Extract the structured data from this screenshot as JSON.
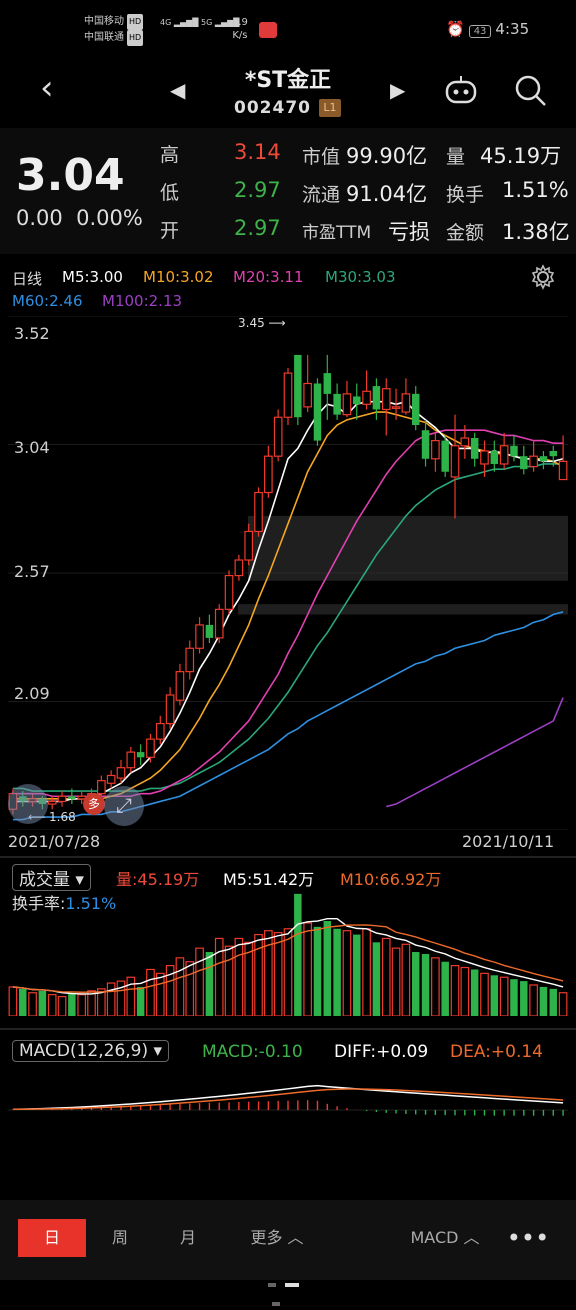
{
  "status_bar": {
    "carrier1": "中国移动",
    "carrier2": "中国联通",
    "hd": "HD",
    "sig": "4G",
    "net_speed": "1.9",
    "net_unit": "K/s",
    "battery": "43",
    "time": "4:35"
  },
  "header": {
    "title": "*ST金正",
    "code": "002470",
    "badge": "L1"
  },
  "quote": {
    "price": "3.04",
    "change": "0.00",
    "change_pct": "0.00%",
    "high_label": "高",
    "high": "3.14",
    "low_label": "低",
    "low": "2.97",
    "open_label": "开",
    "open": "2.97",
    "mktcap_label": "市值",
    "mktcap": "99.90亿",
    "float_label": "流通",
    "float": "91.04亿",
    "pe_label": "市盈TTM",
    "pe": "亏损",
    "vol_label": "量",
    "vol": "45.19万",
    "turn_label": "换手",
    "turn": "1.51%",
    "amt_label": "金额",
    "amt": "1.38亿"
  },
  "indicators": {
    "period": "日线",
    "m5": "M5:3.00",
    "m10": "M10:3.02",
    "m20": "M20:3.11",
    "m30": "M30:3.03",
    "m60": "M60:2.46",
    "m100": "M100:2.13",
    "colors": {
      "m5": "#ffffff",
      "m10": "#f5a623",
      "m20": "#e040b0",
      "m30": "#2aa87a",
      "m60": "#2f8fe0",
      "m100": "#9b3fc4"
    }
  },
  "chart_data": {
    "type": "candlestick",
    "y_ticks": [
      "3.52",
      "3.04",
      "2.57",
      "2.09"
    ],
    "x_start": "2021/07/28",
    "x_end": "2021/10/11",
    "high_marker": "3.45",
    "low_marker": "1.68",
    "ylim": [
      1.62,
      3.6
    ],
    "candles": [
      {
        "o": 1.7,
        "c": 1.76,
        "h": 1.78,
        "l": 1.68
      },
      {
        "o": 1.75,
        "c": 1.73,
        "h": 1.77,
        "l": 1.71
      },
      {
        "o": 1.73,
        "c": 1.74,
        "h": 1.76,
        "l": 1.71
      },
      {
        "o": 1.74,
        "c": 1.72,
        "h": 1.75,
        "l": 1.7
      },
      {
        "o": 1.72,
        "c": 1.73,
        "h": 1.75,
        "l": 1.7
      },
      {
        "o": 1.73,
        "c": 1.75,
        "h": 1.77,
        "l": 1.71
      },
      {
        "o": 1.75,
        "c": 1.74,
        "h": 1.78,
        "l": 1.72
      },
      {
        "o": 1.74,
        "c": 1.75,
        "h": 1.77,
        "l": 1.72
      },
      {
        "o": 1.75,
        "c": 1.76,
        "h": 1.78,
        "l": 1.73
      },
      {
        "o": 1.76,
        "c": 1.81,
        "h": 1.83,
        "l": 1.74
      },
      {
        "o": 1.8,
        "c": 1.83,
        "h": 1.85,
        "l": 1.78
      },
      {
        "o": 1.82,
        "c": 1.86,
        "h": 1.89,
        "l": 1.8
      },
      {
        "o": 1.86,
        "c": 1.92,
        "h": 1.94,
        "l": 1.84
      },
      {
        "o": 1.92,
        "c": 1.9,
        "h": 1.95,
        "l": 1.87
      },
      {
        "o": 1.9,
        "c": 1.97,
        "h": 1.99,
        "l": 1.88
      },
      {
        "o": 1.97,
        "c": 2.03,
        "h": 2.06,
        "l": 1.95
      },
      {
        "o": 2.03,
        "c": 2.14,
        "h": 2.17,
        "l": 2.01
      },
      {
        "o": 2.12,
        "c": 2.23,
        "h": 2.26,
        "l": 2.1
      },
      {
        "o": 2.23,
        "c": 2.32,
        "h": 2.35,
        "l": 2.2
      },
      {
        "o": 2.32,
        "c": 2.41,
        "h": 2.44,
        "l": 2.3
      },
      {
        "o": 2.41,
        "c": 2.36,
        "h": 2.45,
        "l": 2.34
      },
      {
        "o": 2.36,
        "c": 2.47,
        "h": 2.49,
        "l": 2.34
      },
      {
        "o": 2.47,
        "c": 2.6,
        "h": 2.62,
        "l": 2.45
      },
      {
        "o": 2.6,
        "c": 2.66,
        "h": 2.68,
        "l": 2.58
      },
      {
        "o": 2.66,
        "c": 2.77,
        "h": 2.8,
        "l": 2.64
      },
      {
        "o": 2.77,
        "c": 2.92,
        "h": 2.94,
        "l": 2.75
      },
      {
        "o": 2.92,
        "c": 3.06,
        "h": 3.1,
        "l": 2.9
      },
      {
        "o": 3.06,
        "c": 3.21,
        "h": 3.24,
        "l": 3.04
      },
      {
        "o": 3.21,
        "c": 3.38,
        "h": 3.4,
        "l": 3.18
      },
      {
        "o": 3.45,
        "c": 3.21,
        "h": 3.45,
        "l": 3.18
      },
      {
        "o": 3.25,
        "c": 3.34,
        "h": 3.45,
        "l": 3.23
      },
      {
        "o": 3.34,
        "c": 3.12,
        "h": 3.36,
        "l": 3.1
      },
      {
        "o": 3.38,
        "c": 3.3,
        "h": 3.45,
        "l": 3.2
      },
      {
        "o": 3.3,
        "c": 3.22,
        "h": 3.34,
        "l": 3.2
      },
      {
        "o": 3.22,
        "c": 3.3,
        "h": 3.35,
        "l": 3.21
      },
      {
        "o": 3.29,
        "c": 3.26,
        "h": 3.34,
        "l": 3.2
      },
      {
        "o": 3.26,
        "c": 3.31,
        "h": 3.39,
        "l": 3.24
      },
      {
        "o": 3.33,
        "c": 3.24,
        "h": 3.36,
        "l": 3.2
      },
      {
        "o": 3.24,
        "c": 3.32,
        "h": 3.36,
        "l": 3.14
      },
      {
        "o": 3.25,
        "c": 3.25,
        "h": 3.32,
        "l": 3.2
      },
      {
        "o": 3.23,
        "c": 3.3,
        "h": 3.36,
        "l": 3.22
      },
      {
        "o": 3.3,
        "c": 3.18,
        "h": 3.33,
        "l": 3.16
      },
      {
        "o": 3.16,
        "c": 3.05,
        "h": 3.2,
        "l": 3.02
      },
      {
        "o": 3.05,
        "c": 3.12,
        "h": 3.15,
        "l": 3.0
      },
      {
        "o": 3.12,
        "c": 3.0,
        "h": 3.14,
        "l": 2.98
      },
      {
        "o": 2.98,
        "c": 3.1,
        "h": 3.22,
        "l": 2.82
      },
      {
        "o": 3.1,
        "c": 3.13,
        "h": 3.18,
        "l": 3.05
      },
      {
        "o": 3.13,
        "c": 3.05,
        "h": 3.15,
        "l": 3.02
      },
      {
        "o": 3.03,
        "c": 3.08,
        "h": 3.12,
        "l": 2.98
      },
      {
        "o": 3.08,
        "c": 3.03,
        "h": 3.12,
        "l": 3.0
      },
      {
        "o": 3.03,
        "c": 3.1,
        "h": 3.15,
        "l": 3.01
      },
      {
        "o": 3.1,
        "c": 3.06,
        "h": 3.14,
        "l": 3.04
      },
      {
        "o": 3.06,
        "c": 3.01,
        "h": 3.1,
        "l": 2.99
      },
      {
        "o": 3.02,
        "c": 3.06,
        "h": 3.12,
        "l": 3.0
      },
      {
        "o": 3.06,
        "c": 3.04,
        "h": 3.08,
        "l": 3.01
      },
      {
        "o": 3.08,
        "c": 3.06,
        "h": 3.1,
        "l": 3.02
      },
      {
        "o": 2.97,
        "c": 3.04,
        "h": 3.14,
        "l": 2.97
      }
    ],
    "ma5": [
      1.73,
      1.73,
      1.73,
      1.73,
      1.73,
      1.73,
      1.74,
      1.74,
      1.75,
      1.76,
      1.78,
      1.8,
      1.84,
      1.86,
      1.9,
      1.94,
      2.0,
      2.07,
      2.15,
      2.24,
      2.3,
      2.37,
      2.45,
      2.51,
      2.58,
      2.7,
      2.81,
      2.93,
      3.05,
      3.09,
      3.16,
      3.22,
      3.26,
      3.25,
      3.22,
      3.26,
      3.27,
      3.27,
      3.27,
      3.26,
      3.27,
      3.23,
      3.2,
      3.17,
      3.13,
      3.09,
      3.09,
      3.09,
      3.07,
      3.08,
      3.07,
      3.06,
      3.05,
      3.05,
      3.04,
      3.04,
      3.05
    ],
    "ma10": [
      1.74,
      1.74,
      1.74,
      1.74,
      1.74,
      1.74,
      1.74,
      1.74,
      1.74,
      1.74,
      1.75,
      1.76,
      1.78,
      1.8,
      1.82,
      1.85,
      1.89,
      1.93,
      1.99,
      2.05,
      2.12,
      2.18,
      2.25,
      2.33,
      2.41,
      2.51,
      2.6,
      2.7,
      2.8,
      2.9,
      3.0,
      3.07,
      3.14,
      3.18,
      3.2,
      3.21,
      3.22,
      3.23,
      3.23,
      3.22,
      3.21,
      3.2,
      3.19,
      3.16,
      3.14,
      3.12,
      3.1,
      3.09,
      3.08,
      3.07,
      3.07,
      3.06,
      3.05,
      3.05,
      3.05,
      3.04,
      3.02
    ],
    "ma20": [
      1.76,
      1.76,
      1.76,
      1.76,
      1.75,
      1.75,
      1.75,
      1.75,
      1.75,
      1.75,
      1.75,
      1.75,
      1.75,
      1.76,
      1.76,
      1.77,
      1.79,
      1.81,
      1.83,
      1.86,
      1.89,
      1.92,
      1.96,
      2.0,
      2.04,
      2.1,
      2.16,
      2.22,
      2.3,
      2.37,
      2.45,
      2.53,
      2.6,
      2.67,
      2.74,
      2.81,
      2.87,
      2.93,
      2.99,
      3.04,
      3.08,
      3.12,
      3.14,
      3.15,
      3.16,
      3.16,
      3.16,
      3.16,
      3.16,
      3.15,
      3.14,
      3.14,
      3.13,
      3.12,
      3.12,
      3.11,
      3.11
    ],
    "ma30": [
      1.78,
      1.78,
      1.77,
      1.77,
      1.77,
      1.77,
      1.77,
      1.77,
      1.77,
      1.77,
      1.77,
      1.77,
      1.77,
      1.77,
      1.78,
      1.78,
      1.79,
      1.8,
      1.82,
      1.84,
      1.86,
      1.88,
      1.91,
      1.94,
      1.97,
      2.01,
      2.05,
      2.1,
      2.15,
      2.21,
      2.27,
      2.33,
      2.38,
      2.44,
      2.5,
      2.56,
      2.62,
      2.68,
      2.73,
      2.78,
      2.83,
      2.87,
      2.9,
      2.93,
      2.95,
      2.97,
      2.98,
      2.99,
      3.0,
      3.01,
      3.01,
      3.02,
      3.02,
      3.02,
      3.03,
      3.03,
      3.03
    ],
    "ma60": [
      1.66,
      1.66,
      1.67,
      1.67,
      1.67,
      1.67,
      1.67,
      1.68,
      1.68,
      1.68,
      1.69,
      1.69,
      1.7,
      1.71,
      1.72,
      1.73,
      1.74,
      1.75,
      1.77,
      1.79,
      1.81,
      1.83,
      1.85,
      1.87,
      1.89,
      1.91,
      1.93,
      1.96,
      1.99,
      2.01,
      2.04,
      2.06,
      2.08,
      2.1,
      2.12,
      2.14,
      2.16,
      2.18,
      2.2,
      2.22,
      2.24,
      2.26,
      2.27,
      2.29,
      2.3,
      2.32,
      2.33,
      2.34,
      2.35,
      2.37,
      2.38,
      2.39,
      2.4,
      2.42,
      2.43,
      2.45,
      2.46
    ],
    "ma100": [
      null,
      null,
      null,
      null,
      null,
      null,
      null,
      null,
      null,
      null,
      null,
      null,
      null,
      null,
      null,
      null,
      null,
      null,
      null,
      null,
      null,
      null,
      null,
      null,
      null,
      null,
      null,
      null,
      null,
      null,
      null,
      null,
      null,
      null,
      null,
      null,
      null,
      null,
      1.71,
      1.72,
      1.74,
      1.76,
      1.78,
      1.8,
      1.82,
      1.84,
      1.86,
      1.88,
      1.9,
      1.92,
      1.94,
      1.96,
      1.98,
      2.0,
      2.02,
      2.04,
      2.13
    ]
  },
  "volume": {
    "label": "成交量",
    "vol": "量:45.19万",
    "m5": "M5:51.42万",
    "m10": "M10:66.92万",
    "turnover_label": "换手率:",
    "turnover": "1.51%"
  },
  "macd": {
    "label": "MACD(12,26,9)",
    "macd": "MACD:-0.10",
    "diff": "DIFF:+0.09",
    "dea": "DEA:+0.14"
  },
  "bottom_tabs": {
    "day": "日",
    "week": "周",
    "month": "月",
    "more": "更多",
    "indicator": "MACD"
  },
  "badges": {
    "duo": "多"
  }
}
